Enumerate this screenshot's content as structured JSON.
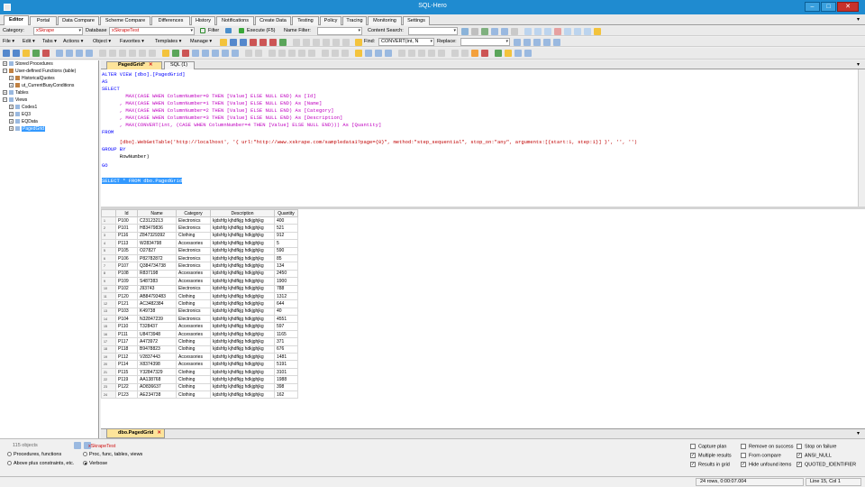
{
  "window": {
    "title": "SQL-Hero",
    "minimize": "–",
    "maximize": "□",
    "close": "✕"
  },
  "main_tabs": [
    "Editor",
    "Portal",
    "Data Compare",
    "Scheme Compare",
    "Differences",
    "History",
    "Notifications",
    "Create Data",
    "Testing",
    "Policy",
    "Tracing",
    "Monitoring",
    "Settings"
  ],
  "toolbar1": {
    "category_label": "Category:",
    "category_value": "xSkrape",
    "database_label": "Database",
    "database_value": "xSkrapeTest",
    "filter_label": "Filter",
    "execute_label": "Execute (F5)",
    "name_filter_label": "Name Filter:",
    "content_search_label": "Content Search:"
  },
  "toolbar2": {
    "menus": [
      "File ▾",
      "Edit ▾",
      "Tabs ▾",
      "Actions ▾",
      "Object ▾",
      "Favorites ▾",
      "Templates ▾",
      "Manage ▾"
    ],
    "find_label": "Find:",
    "find_value": "CONVERT(int, N",
    "replace_label": "Replace:"
  },
  "tree": [
    {
      "label": "Stored Procedures",
      "level": 0,
      "expander": "+"
    },
    {
      "label": "User-defined Functions (table)",
      "level": 0,
      "expander": "−"
    },
    {
      "label": "HistoricalQuotes",
      "level": 1,
      "expander": "+"
    },
    {
      "label": "ut_CurrentBusyConditions",
      "level": 1,
      "expander": "+"
    },
    {
      "label": "Tables",
      "level": 0,
      "expander": "+"
    },
    {
      "label": "Views",
      "level": 0,
      "expander": "−"
    },
    {
      "label": "Codes1",
      "level": 1,
      "expander": "+"
    },
    {
      "label": "EQ3",
      "level": 1,
      "expander": "+"
    },
    {
      "label": "EQData",
      "level": 1,
      "expander": "+"
    },
    {
      "label": "PagedGrid",
      "level": 1,
      "expander": "+",
      "selected": true
    }
  ],
  "doc_tabs": [
    {
      "label": "PagedGrid*",
      "active": true,
      "close": "✕"
    },
    {
      "label": "SQL (1)",
      "active": false
    }
  ],
  "code": {
    "l1": "ALTER VIEW [dbo].[PagedGrid]",
    "l2": "AS",
    "l3": "SELECT",
    "l4": "        MAX(CASE WHEN ColumnNumber=0 THEN [Value] ELSE NULL END) As [Id]",
    "l5": "      , MAX(CASE WHEN ColumnNumber=1 THEN [Value] ELSE NULL END) As [Name]",
    "l6": "      , MAX(CASE WHEN ColumnNumber=2 THEN [Value] ELSE NULL END) As [Category]",
    "l7": "      , MAX(CASE WHEN ColumnNumber=3 THEN [Value] ELSE NULL END) As [Description]",
    "l8": "      , MAX(CONVERT(int, (CASE WHEN ColumnNumber=4 THEN [Value] ELSE NULL END))) As [Quantity]",
    "l9": "FROM",
    "l10": "      [dbo].WebGetTable('http://localhost', '{ url:\"http://www.xskrape.com/sampledata1?page={0}\", method:\"step_sequential\", stop_on:\"any\", arguments:[{start:1, step:1}] }', '', '')",
    "l11": "GROUP BY",
    "l12": "      RowNumber)",
    "l13": "GO",
    "l14": "SELECT * FROM dbo.PagedGrid"
  },
  "grid": {
    "columns": [
      "Id",
      "Name",
      "Category",
      "Description",
      "Quantity"
    ],
    "rows": [
      [
        "1",
        "P100",
        "C23123213",
        "Electronics",
        "kjdshfg kjhdfkjg hdkjghjkg",
        "400"
      ],
      [
        "2",
        "P101",
        "H83479836",
        "Electronics",
        "kjdshfg kjhdfkjg hdkjghjkg",
        "521"
      ],
      [
        "3",
        "P116",
        "Z847329392",
        "Clothing",
        "kjdshfg kjhdfkjg hdkjghjkg",
        "912"
      ],
      [
        "4",
        "P113",
        "W2834798",
        "Accessories",
        "kjdshfg kjhdfkjg hdkjghjkg",
        "5"
      ],
      [
        "5",
        "P105",
        "O27827",
        "Electronics",
        "kjdshfg kjhdfkjg hdkjghjkg",
        "590"
      ],
      [
        "6",
        "P106",
        "P82782872",
        "Electronics",
        "kjdshfg kjhdfkjg hdkjghjkg",
        "85"
      ],
      [
        "7",
        "P107",
        "Q384734738",
        "Electronics",
        "kjdshfg kjhdfkjg hdkjghjkg",
        "134"
      ],
      [
        "8",
        "P108",
        "R837198",
        "Accessories",
        "kjdshfg kjhdfkjg hdkjghjkg",
        "2450"
      ],
      [
        "9",
        "P109",
        "S487383",
        "Accessories",
        "kjdshfg kjhdfkjg hdkjghjkg",
        "1900"
      ],
      [
        "10",
        "P102",
        "J93743",
        "Electronics",
        "kjdshfg kjhdfkjg hdkjghjkg",
        "788"
      ],
      [
        "11",
        "P120",
        "AB84793483",
        "Clothing",
        "kjdshfg kjhdfkjg hdkjghjkg",
        "1312"
      ],
      [
        "12",
        "P121",
        "AC3482384",
        "Clothing",
        "kjdshfg kjhdfkjg hdkjghjkg",
        "644"
      ],
      [
        "13",
        "P103",
        "K49738",
        "Electronics",
        "kjdshfg kjhdfkjg hdkjghjkg",
        "40"
      ],
      [
        "14",
        "P104",
        "N32847239",
        "Electronics",
        "kjdshfg kjhdfkjg hdkjghjkg",
        "4551"
      ],
      [
        "15",
        "P110",
        "T328437",
        "Accessories",
        "kjdshfg kjhdfkjg hdkjghjkg",
        "597"
      ],
      [
        "16",
        "P111",
        "U8473948",
        "Accessories",
        "kjdshfg kjhdfkjg hdkjghjkg",
        "1165"
      ],
      [
        "17",
        "P117",
        "A473972",
        "Clothing",
        "kjdshfg kjhdfkjg hdkjghjkg",
        "371"
      ],
      [
        "18",
        "P118",
        "B9478823",
        "Clothing",
        "kjdshfg kjhdfkjg hdkjghjkg",
        "676"
      ],
      [
        "19",
        "P112",
        "V2837443",
        "Accessories",
        "kjdshfg kjhdfkjg hdkjghjkg",
        "1481"
      ],
      [
        "20",
        "P114",
        "X8374398",
        "Accessories",
        "kjdshfg kjhdfkjg hdkjghjkg",
        "5191"
      ],
      [
        "21",
        "P115",
        "Y32847329",
        "Clothing",
        "kjdshfg kjhdfkjg hdkjghjkg",
        "3101"
      ],
      [
        "22",
        "P119",
        "AA138768",
        "Clothing",
        "kjdshfg kjhdfkjg hdkjghjkg",
        "1988"
      ],
      [
        "23",
        "P122",
        "AD836637",
        "Clothing",
        "kjdshfg kjhdfkjg hdkjghjkg",
        "398"
      ],
      [
        "24",
        "P123",
        "AE234738",
        "Clothing",
        "kjdshfg kjhdfkjg hdkjghjkg",
        "162"
      ]
    ]
  },
  "result_tab": {
    "label": "dbo.PagedGrid",
    "close": "✕"
  },
  "bottom": {
    "objects_count": "115 objects",
    "opt_procedures": "Procedures, functions",
    "opt_above_plus": "Above plus constraints, etc.",
    "db_name": "xSkrapeTest",
    "opt_proc_func": "Proc, func, tables, views",
    "opt_verbose": "Verbose",
    "checks": [
      {
        "label": "Capture plan",
        "checked": false
      },
      {
        "label": "Multiple results",
        "checked": true
      },
      {
        "label": "Results in grid",
        "checked": true
      },
      {
        "label": "Remove on success",
        "checked": false
      },
      {
        "label": "From compare",
        "checked": false
      },
      {
        "label": "Hide unfound items",
        "checked": true
      },
      {
        "label": "Stop on failure",
        "checked": false
      },
      {
        "label": "ANSI_NULL",
        "checked": true
      },
      {
        "label": "QUOTED_IDENTIFIER",
        "checked": true
      }
    ]
  },
  "status": {
    "rows": "24 rows, 0:00:07.004",
    "position": "Line 15, Col 1"
  },
  "colors": {
    "titlebar": "#1f8bd0",
    "selection": "#3399ff",
    "keyword": "#0000ff",
    "function": "#c000c0",
    "string": "#c00000",
    "active_tab": "#fde49a"
  }
}
